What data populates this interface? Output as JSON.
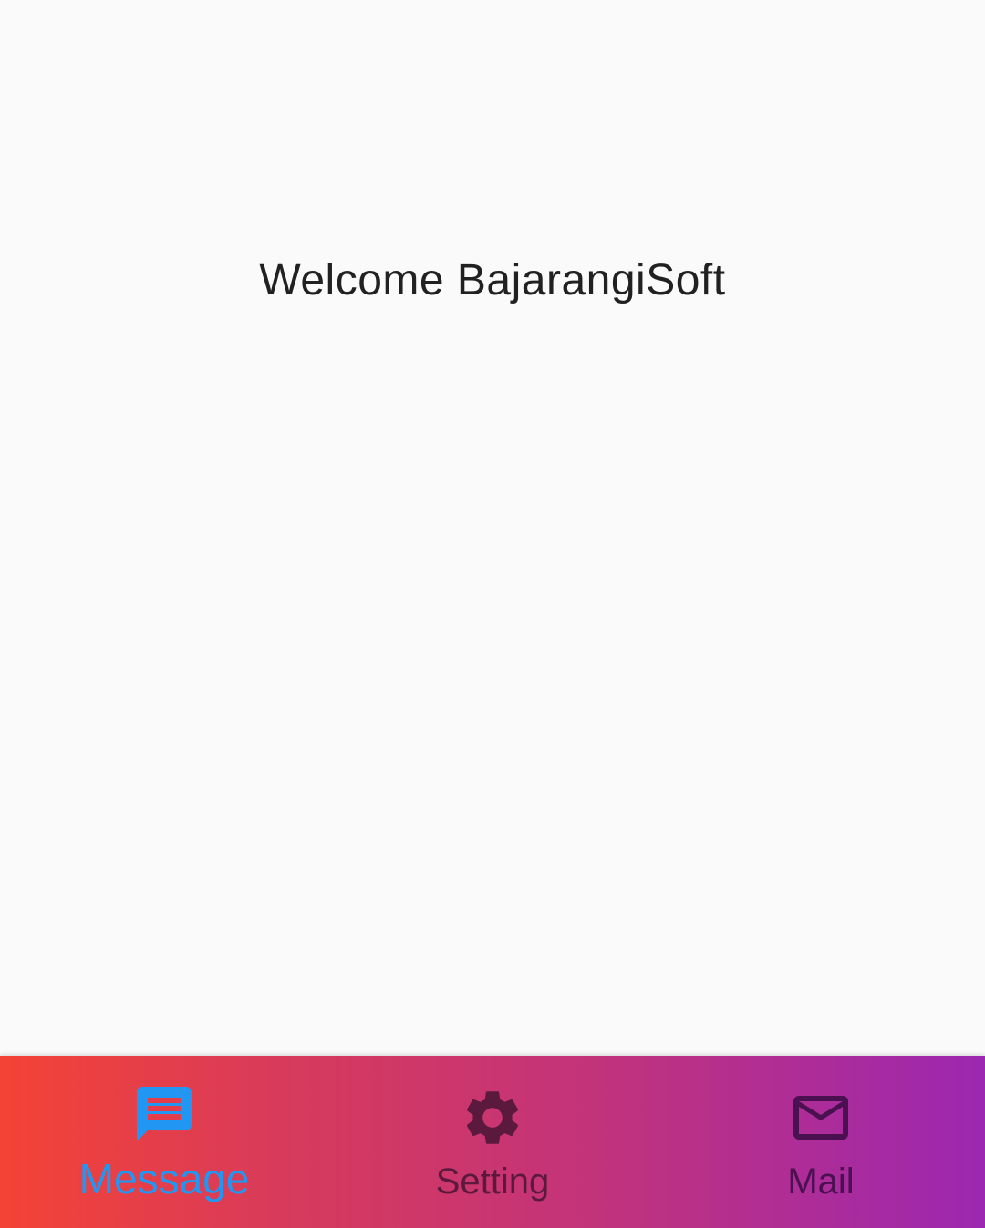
{
  "main": {
    "welcome_text": "Welcome BajarangiSoft"
  },
  "bottom_nav": {
    "selected": "message",
    "items": [
      {
        "id": "message",
        "label": "Message",
        "icon": "message-icon",
        "active": true,
        "color": "#2196f3"
      },
      {
        "id": "setting",
        "label": "Setting",
        "icon": "gear-icon",
        "active": false,
        "color": "#5b1a3d"
      },
      {
        "id": "mail",
        "label": "Mail",
        "icon": "mail-icon",
        "active": false,
        "color": "#4a1050"
      }
    ],
    "gradient": [
      "#f44336",
      "#9c27b0"
    ]
  }
}
